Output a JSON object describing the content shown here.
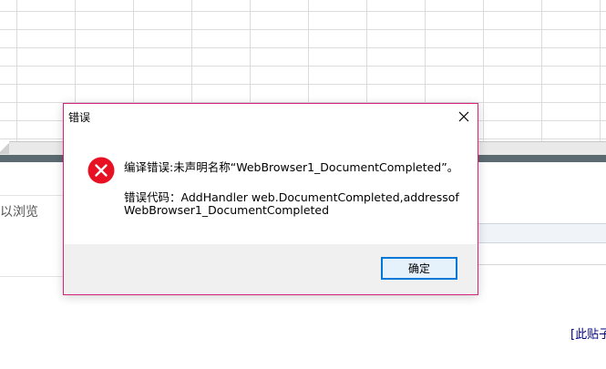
{
  "background": {
    "browse_text": "以浏览",
    "right_link": "[此贴子"
  },
  "dialog": {
    "title": "错误",
    "message_line1": "编译错误:未声明名称“WebBrowser1_DocumentCompleted”。",
    "message_line2": "错误代码：AddHandler web.DocumentCompleted,addressof",
    "message_line3": "WebBrowser1_DocumentCompleted",
    "ok_label": "确定",
    "icon": "error-icon",
    "colors": {
      "border": "#d4237a",
      "icon_red": "#e81123",
      "button_border": "#0078d7",
      "button_fill": "#e5f1fb",
      "footer": "#f0f0f0"
    }
  }
}
